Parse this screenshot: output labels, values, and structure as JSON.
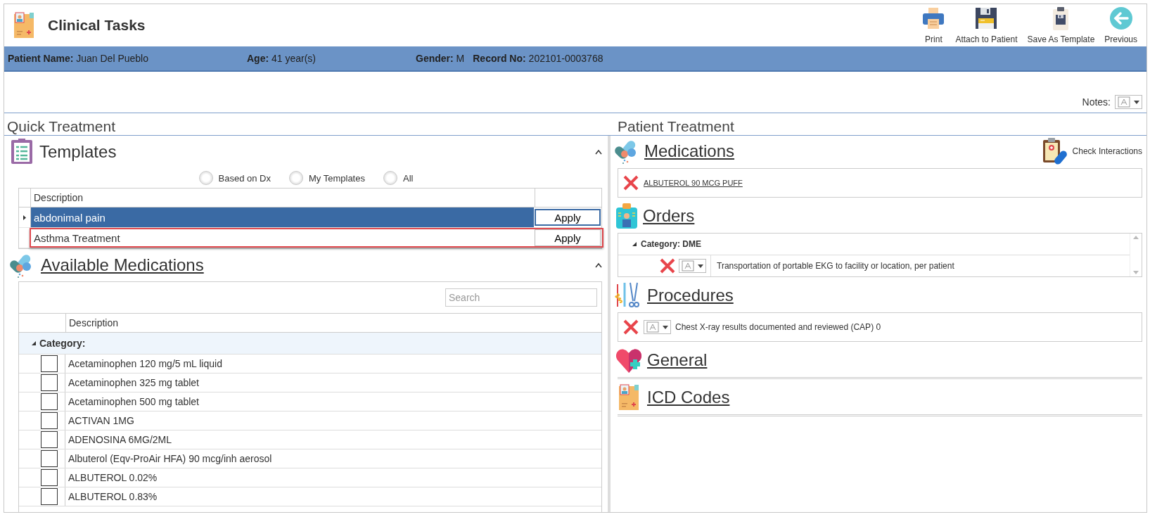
{
  "header": {
    "title": "Clinical Tasks",
    "toolbar": [
      {
        "kind": "print",
        "label": "Print"
      },
      {
        "kind": "attach",
        "label": "Attach to Patient"
      },
      {
        "kind": "save-template",
        "label": "Save As Template"
      },
      {
        "kind": "previous",
        "label": "Previous"
      }
    ]
  },
  "patient_bar": [
    {
      "label": "Patient Name:",
      "value": "Juan Del Pueblo"
    },
    {
      "label": "Age:",
      "value": "41 year(s)"
    },
    {
      "label": "Gender:",
      "value": "M"
    },
    {
      "label": "Record No:",
      "value": "202101-0003768"
    }
  ],
  "notes": {
    "label": "Notes:"
  },
  "quick_treatment": {
    "title": "Quick Treatment",
    "templates": {
      "title": "Templates",
      "expanded": true,
      "filters": [
        {
          "label": "Based on Dx",
          "selected": false
        },
        {
          "label": "My Templates",
          "selected": false
        },
        {
          "label": "All",
          "selected": false
        }
      ],
      "column": "Description",
      "rows": [
        {
          "description": "abdonimal pain",
          "action": "Apply",
          "selected": true,
          "outlined": false
        },
        {
          "description": "Asthma Treatment",
          "action": "Apply",
          "selected": false,
          "outlined": true
        }
      ]
    },
    "available_medications": {
      "title": "Available Medications",
      "expanded": true,
      "search": {
        "placeholder": "Search"
      },
      "column": "Description",
      "group": {
        "label": "Category:",
        "expanded": true
      },
      "rows": [
        {
          "description": "Acetaminophen 120 mg/5 mL liquid",
          "checked": false
        },
        {
          "description": "Acetaminophen 325 mg tablet",
          "checked": false
        },
        {
          "description": "Acetaminophen 500 mg tablet",
          "checked": false
        },
        {
          "description": "ACTIVAN 1MG",
          "checked": false
        },
        {
          "description": "ADENOSINA 6MG/2ML",
          "checked": false
        },
        {
          "description": "Albuterol (Eqv-ProAir HFA) 90 mcg/inh aerosol",
          "checked": false
        },
        {
          "description": "ALBUTEROL 0.02%",
          "checked": false
        },
        {
          "description": "ALBUTEROL 0.83%",
          "checked": false
        }
      ]
    }
  },
  "patient_treatment": {
    "title": "Patient Treatment",
    "sections": [
      {
        "kind": "medications",
        "title": "Medications",
        "action": "Check Interactions",
        "items": [
          {
            "text": "ALBUTEROL 90 MCG PUFF"
          }
        ]
      },
      {
        "kind": "orders",
        "title": "Orders",
        "group": {
          "label": "Category: DME",
          "expanded": true
        },
        "items": [
          {
            "text": "Transportation of portable EKG to facility or location, per patient"
          }
        ]
      },
      {
        "kind": "procedures",
        "title": "Procedures",
        "items": [
          {
            "text": "Chest X-ray results documented and reviewed (CAP) 0"
          }
        ]
      },
      {
        "kind": "general",
        "title": "General"
      },
      {
        "kind": "icd",
        "title": "ICD Codes"
      }
    ]
  }
}
